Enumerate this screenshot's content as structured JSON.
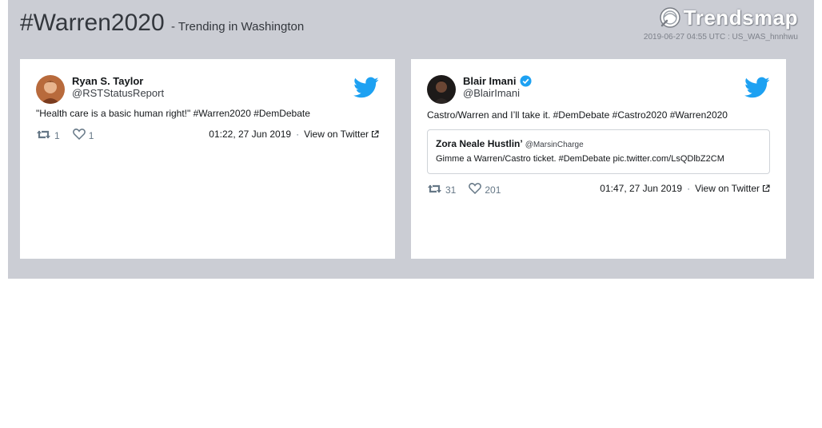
{
  "header": {
    "hashtag": "#Warren2020",
    "subtitle": "- Trending in Washington",
    "logo_text": "Trendsmap",
    "meta": "2019-06-27 04:55 UTC : US_WAS_hnnhwu"
  },
  "colors": {
    "panel": "#cbcdd4",
    "twitter_blue": "#1da1f2",
    "verified": "#1da1f2"
  },
  "tweets": [
    {
      "name": "Ryan S. Taylor",
      "handle": "@RSTStatusReport",
      "verified": false,
      "text": "\"Health care is a basic human right!\" #Warren2020 #DemDebate",
      "retweets": "1",
      "likes": "1",
      "timestamp": "01:22, 27 Jun 2019",
      "separator": "·",
      "link_label": "View on Twitter"
    },
    {
      "name": "Blair Imani",
      "handle": "@BlairImani",
      "verified": true,
      "text": "Castro/Warren and I’ll take it. #DemDebate #Castro2020 #Warren2020",
      "quote": {
        "name": "Zora Neale Hustlin’",
        "handle": "@MarsinCharge",
        "text": "Gimme a Warren/Castro ticket. #DemDebate pic.twitter.com/LsQDlbZ2CM"
      },
      "retweets": "31",
      "likes": "201",
      "timestamp": "01:47, 27 Jun 2019",
      "separator": "·",
      "link_label": "View on Twitter"
    }
  ]
}
